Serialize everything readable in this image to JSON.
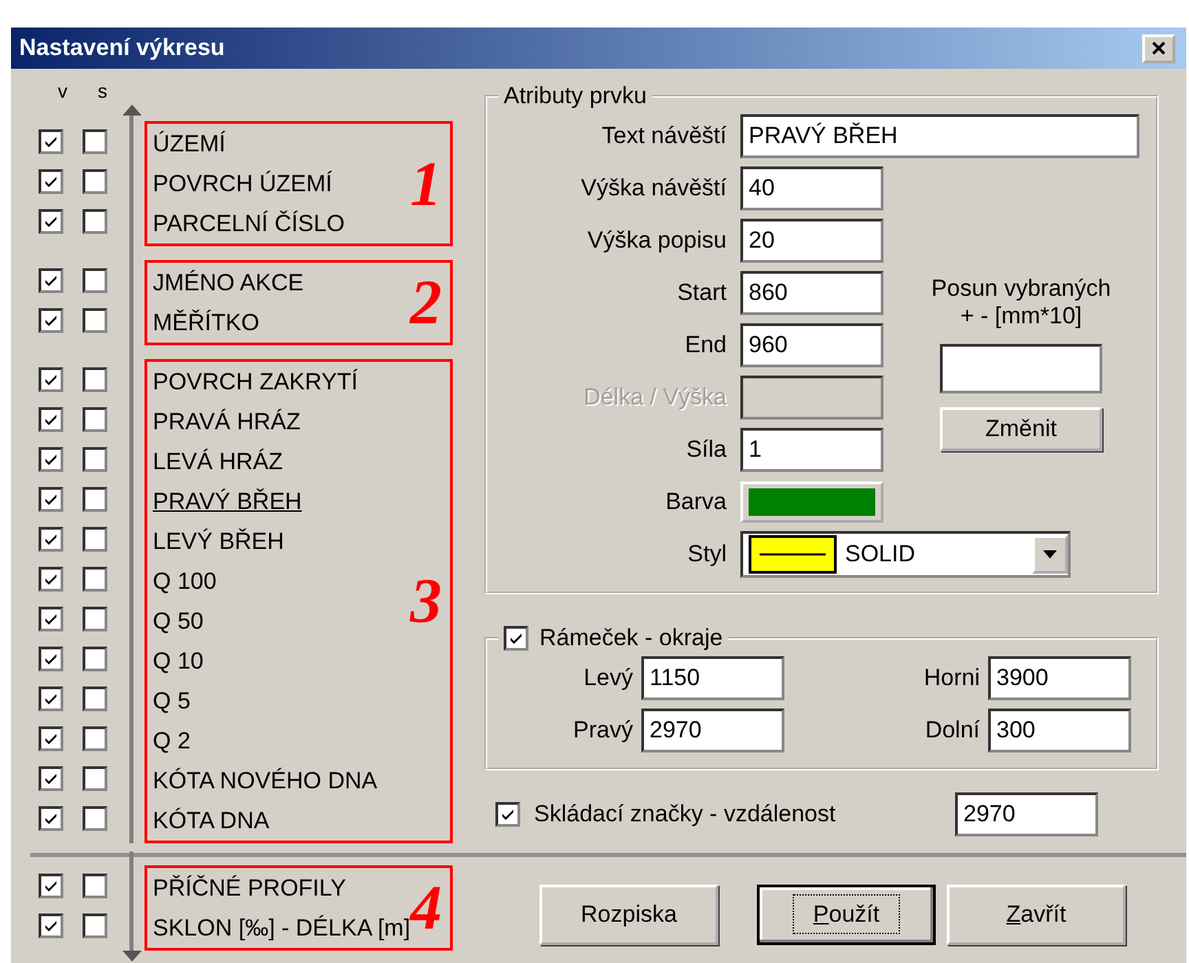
{
  "window": {
    "title": "Nastavení výkresu"
  },
  "columns": [
    "v",
    "s"
  ],
  "groups": [
    {
      "number": "1",
      "items": [
        {
          "label": "ÚZEMÍ",
          "v_checked": true,
          "s_checked": false,
          "selected": false
        },
        {
          "label": "POVRCH ÚZEMÍ",
          "v_checked": true,
          "s_checked": false,
          "selected": false
        },
        {
          "label": "PARCELNÍ ČÍSLO",
          "v_checked": true,
          "s_checked": false,
          "selected": false
        }
      ]
    },
    {
      "number": "2",
      "items": [
        {
          "label": "JMÉNO AKCE",
          "v_checked": true,
          "s_checked": false,
          "selected": false
        },
        {
          "label": "MĚŘÍTKO",
          "v_checked": true,
          "s_checked": false,
          "selected": false
        }
      ]
    },
    {
      "number": "3",
      "items": [
        {
          "label": "POVRCH ZAKRYTÍ",
          "v_checked": true,
          "s_checked": false,
          "selected": false
        },
        {
          "label": "PRAVÁ HRÁZ",
          "v_checked": true,
          "s_checked": false,
          "selected": false
        },
        {
          "label": "LEVÁ HRÁZ",
          "v_checked": true,
          "s_checked": false,
          "selected": false
        },
        {
          "label": "PRAVÝ BŘEH",
          "v_checked": true,
          "s_checked": false,
          "selected": true
        },
        {
          "label": "LEVÝ BŘEH",
          "v_checked": true,
          "s_checked": false,
          "selected": false
        },
        {
          "label": "Q 100",
          "v_checked": true,
          "s_checked": false,
          "selected": false
        },
        {
          "label": "Q 50",
          "v_checked": true,
          "s_checked": false,
          "selected": false
        },
        {
          "label": "Q 10",
          "v_checked": true,
          "s_checked": false,
          "selected": false
        },
        {
          "label": "Q 5",
          "v_checked": true,
          "s_checked": false,
          "selected": false
        },
        {
          "label": "Q 2",
          "v_checked": true,
          "s_checked": false,
          "selected": false
        },
        {
          "label": "KÓTA NOVÉHO DNA",
          "v_checked": true,
          "s_checked": false,
          "selected": false
        },
        {
          "label": "KÓTA DNA",
          "v_checked": true,
          "s_checked": false,
          "selected": false
        }
      ]
    },
    {
      "number": "4",
      "items": [
        {
          "label": "PŘÍČNÉ PROFILY",
          "v_checked": true,
          "s_checked": false,
          "selected": false
        },
        {
          "label": "SKLON [‰] - DÉLKA [m]",
          "v_checked": true,
          "s_checked": false,
          "selected": false
        }
      ]
    }
  ],
  "attributes": {
    "title": "Atributy prvku",
    "fields": [
      {
        "kind": "wide-text",
        "label": "Text návěští",
        "value": "PRAVÝ BŘEH",
        "disabled": false
      },
      {
        "kind": "text",
        "label": "Výška návěští",
        "value": "40",
        "disabled": false
      },
      {
        "kind": "text",
        "label": "Výška popisu",
        "value": "20",
        "disabled": false
      },
      {
        "kind": "text",
        "label": "Start",
        "value": "860",
        "disabled": false
      },
      {
        "kind": "text",
        "label": "End",
        "value": "960",
        "disabled": false
      },
      {
        "kind": "text",
        "label": "Délka / Výška",
        "disabled": true
      },
      {
        "kind": "text",
        "label": "Síla",
        "value": "1",
        "disabled": false
      },
      {
        "kind": "color",
        "label": "Barva",
        "color": "#008000"
      },
      {
        "kind": "select",
        "label": "Styl",
        "value": "SOLID"
      }
    ]
  },
  "shift": {
    "label_lines": [
      "Posun vybraných",
      "+ - [mm*10]"
    ],
    "button": "Změnit"
  },
  "frame": {
    "label": "Rámeček - okraje",
    "checked": true,
    "fields": [
      {
        "label": "Levý",
        "value": "1150"
      },
      {
        "label": "Horni",
        "value": "3900"
      },
      {
        "label": "Pravý",
        "value": "2970"
      },
      {
        "label": "Dolní",
        "value": "300"
      }
    ]
  },
  "fold_marks": {
    "label": "Skládací značky - vzdálenost",
    "checked": true,
    "value": "2970"
  },
  "buttons": [
    {
      "label": "Rozpiska",
      "default": false
    },
    {
      "label": "Použít",
      "default": true,
      "mnemonic": true
    },
    {
      "label": "Zavřít",
      "default": false,
      "mnemonic": true
    }
  ]
}
